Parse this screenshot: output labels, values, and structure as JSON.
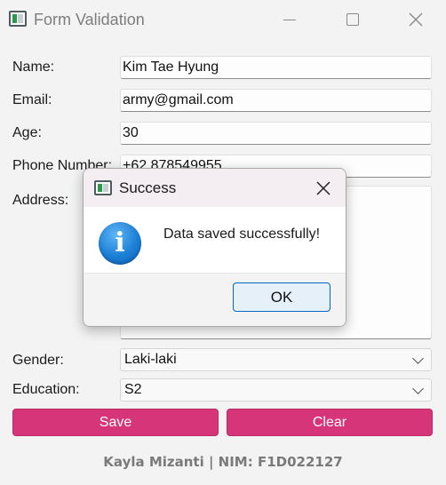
{
  "window": {
    "title": "Form Validation",
    "icon": "app-window-icon"
  },
  "form": {
    "name_label": "Name:",
    "name_value": "Kim Tae Hyung",
    "email_label": "Email:",
    "email_value": "army@gmail.com",
    "age_label": "Age:",
    "age_value": "30",
    "phone_label": "Phone Number:",
    "phone_value": "+62 878549955",
    "address_label": "Address:",
    "address_value": "",
    "gender_label": "Gender:",
    "gender_value": "Laki-laki",
    "education_label": "Education:",
    "education_value": "S2",
    "save_label": "Save",
    "clear_label": "Clear"
  },
  "footer": {
    "text": "Kayla Mizanti | NIM: F1D022127"
  },
  "dialog": {
    "title": "Success",
    "message": "Data saved successfully!",
    "ok_label": "OK",
    "icon": "info-icon"
  },
  "colors": {
    "accent": "#d6357a",
    "background": "#f3f3f3",
    "ok_border": "#0067c0"
  }
}
